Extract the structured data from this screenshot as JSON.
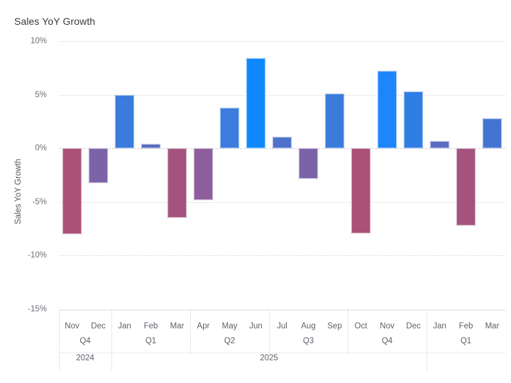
{
  "chart_data": {
    "type": "bar",
    "title": "Sales YoY Growth",
    "xlabel": "",
    "ylabel": "Sales YoY Growth",
    "ylim": [
      -15,
      10
    ],
    "yticks": [
      "10%",
      "5%",
      "0%",
      "-5%",
      "-10%",
      "-15%"
    ],
    "ytick_values": [
      10,
      5,
      0,
      -5,
      -10,
      -15
    ],
    "grid": true,
    "legend": "none",
    "value_suffix": "%",
    "categories": [
      "Nov",
      "Dec",
      "Jan",
      "Feb",
      "Mar",
      "Apr",
      "May",
      "Jun",
      "Jul",
      "Aug",
      "Sep",
      "Oct",
      "Nov",
      "Dec",
      "Jan",
      "Feb",
      "Mar"
    ],
    "values": [
      -8.0,
      -3.2,
      5.0,
      0.4,
      -6.5,
      -4.8,
      3.8,
      8.4,
      1.1,
      -2.8,
      5.1,
      -7.9,
      7.2,
      5.3,
      0.7,
      -7.2,
      2.8
    ],
    "bar_colors": [
      "#AB5076",
      "#7C63A8",
      "#3A7BDC",
      "#5A6CC0",
      "#A4537F",
      "#8D5E9B",
      "#3B7CDC",
      "#1089FF",
      "#4E72CC",
      "#7C63A8",
      "#3A7BDC",
      "#AB5076",
      "#1C86FA",
      "#2F7EE4",
      "#5A6CC0",
      "#A4537F",
      "#4474D2"
    ],
    "quarters": [
      {
        "label": "Q4",
        "months": [
          "Nov",
          "Dec"
        ]
      },
      {
        "label": "Q1",
        "months": [
          "Jan",
          "Feb",
          "Mar"
        ]
      },
      {
        "label": "Q2",
        "months": [
          "Apr",
          "May",
          "Jun"
        ]
      },
      {
        "label": "Q3",
        "months": [
          "Jul",
          "Aug",
          "Sep"
        ]
      },
      {
        "label": "Q4",
        "months": [
          "Oct",
          "Nov",
          "Dec"
        ]
      },
      {
        "label": "Q1",
        "months": [
          "Jan",
          "Feb",
          "Mar"
        ]
      }
    ],
    "years": [
      {
        "label": "2024",
        "span": 2
      },
      {
        "label": "2025",
        "span": 12
      },
      {
        "label": "",
        "span": 3
      }
    ]
  }
}
